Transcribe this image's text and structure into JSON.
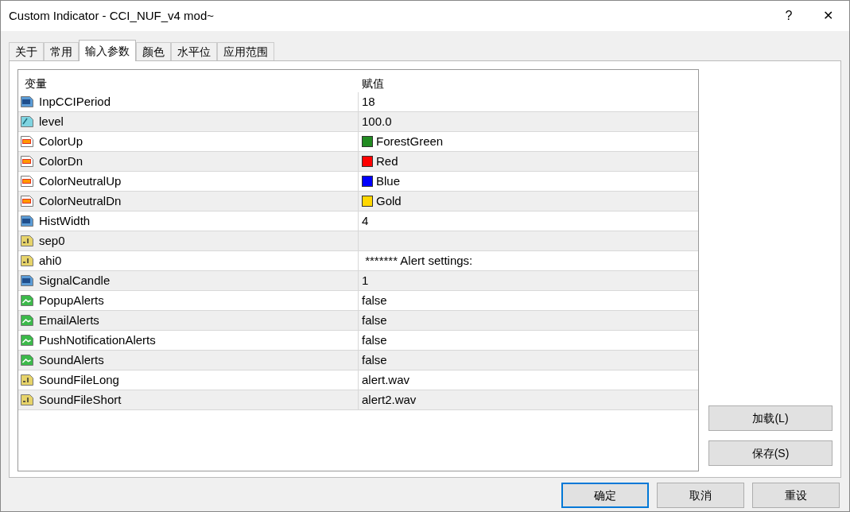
{
  "window": {
    "title": "Custom Indicator - CCI_NUF_v4 mod~",
    "help": "?",
    "close": "✕"
  },
  "tabs": [
    {
      "label": "关于",
      "selected": false
    },
    {
      "label": "常用",
      "selected": false
    },
    {
      "label": "输入参数",
      "selected": true
    },
    {
      "label": "颜色",
      "selected": false
    },
    {
      "label": "水平位",
      "selected": false
    },
    {
      "label": "应用范围",
      "selected": false
    }
  ],
  "table": {
    "columns": [
      "变量",
      "赋值"
    ],
    "rows": [
      {
        "kind": "int",
        "name": "InpCCIPeriod",
        "value": "18"
      },
      {
        "kind": "double",
        "name": "level",
        "value": "100.0"
      },
      {
        "kind": "color",
        "name": "ColorUp",
        "value": "ForestGreen",
        "color": "#228b22"
      },
      {
        "kind": "color",
        "name": "ColorDn",
        "value": "Red",
        "color": "#ff0000"
      },
      {
        "kind": "color",
        "name": "ColorNeutralUp",
        "value": "Blue",
        "color": "#0000ff"
      },
      {
        "kind": "color",
        "name": "ColorNeutralDn",
        "value": "Gold",
        "color": "#ffd700"
      },
      {
        "kind": "int",
        "name": "HistWidth",
        "value": "4"
      },
      {
        "kind": "string",
        "name": "sep0"
      },
      {
        "kind": "string",
        "name": "ahi0",
        "value": " ******* Alert settings:"
      },
      {
        "kind": "int",
        "name": "SignalCandle",
        "value": "1"
      },
      {
        "kind": "bool",
        "name": "PopupAlerts",
        "value": "false"
      },
      {
        "kind": "bool",
        "name": "EmailAlerts",
        "value": "false"
      },
      {
        "kind": "bool",
        "name": "PushNotificationAlerts",
        "value": "false"
      },
      {
        "kind": "bool",
        "name": "SoundAlerts",
        "value": "false"
      },
      {
        "kind": "string",
        "name": "SoundFileLong",
        "value": "alert.wav"
      },
      {
        "kind": "string",
        "name": "SoundFileShort",
        "value": "alert2.wav"
      }
    ]
  },
  "side_buttons": [
    "加载(L)",
    "保存(S)"
  ],
  "buttons": [
    {
      "label": "确定",
      "selected": true
    },
    {
      "label": "取消",
      "selected": false
    },
    {
      "label": "重设",
      "selected": false
    }
  ]
}
